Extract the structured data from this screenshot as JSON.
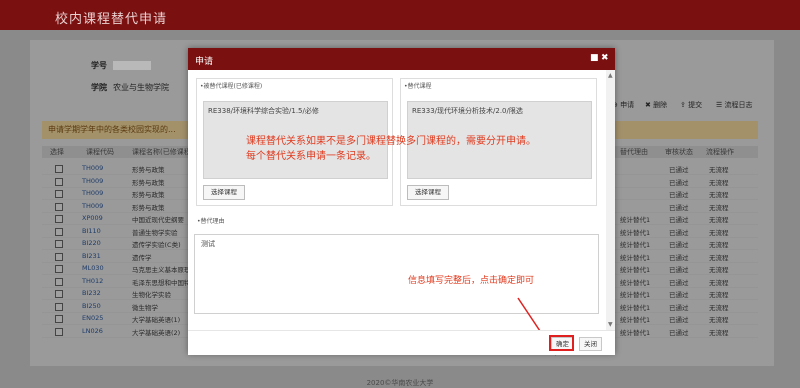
{
  "app": {
    "title": "校内课程替代申请"
  },
  "student": {
    "id_label": "学号",
    "college_label": "学院",
    "college_value": "农业与生物学院"
  },
  "toolbar": {
    "apply_label": "申请",
    "delete_label": "删除",
    "submit_label": "提交",
    "flow_label": "流程日志"
  },
  "notice": "申请学期学年中的各类校园实现的...",
  "table": {
    "headers": [
      "选择",
      "课程代码",
      "课程名称(已修课程)",
      "",
      "",
      "",
      "替代理由",
      "审核状态",
      "流程操作"
    ],
    "rows": [
      {
        "code": "TH009",
        "name": "形势与政策",
        "reason": "",
        "status": "已通过",
        "op": "无流程"
      },
      {
        "code": "TH009",
        "name": "形势与政策",
        "reason": "",
        "status": "已通过",
        "op": "无流程"
      },
      {
        "code": "TH009",
        "name": "形势与政策",
        "reason": "",
        "status": "已通过",
        "op": "无流程"
      },
      {
        "code": "TH009",
        "name": "形势与政策",
        "reason": "",
        "status": "已通过",
        "op": "无流程"
      },
      {
        "code": "XP009",
        "name": "中国近现代史纲要",
        "reason": "统计替代1",
        "status": "已通过",
        "op": "无流程"
      },
      {
        "code": "BI110",
        "name": "普通生物学实验",
        "reason": "统计替代1",
        "status": "已通过",
        "op": "无流程"
      },
      {
        "code": "BI220",
        "name": "遗传学实验(C类)",
        "reason": "统计替代1",
        "status": "已通过",
        "op": "无流程"
      },
      {
        "code": "BI231",
        "name": "遗传学",
        "reason": "统计替代1",
        "status": "已通过",
        "op": "无流程"
      },
      {
        "code": "ML030",
        "name": "马克思主义基本原理概论",
        "reason": "统计替代1",
        "status": "已通过",
        "op": "无流程"
      },
      {
        "code": "TH012",
        "name": "毛泽东思想和中国特色",
        "reason": "统计替代1",
        "status": "已通过",
        "op": "无流程"
      },
      {
        "code": "BI232",
        "name": "生物化学实验",
        "reason": "统计替代1",
        "status": "已通过",
        "op": "无流程"
      },
      {
        "code": "BI250",
        "name": "微生物学",
        "reason": "统计替代1",
        "status": "已通过",
        "op": "无流程"
      },
      {
        "code": "EN025",
        "name": "大学基础英语(1)",
        "reason": "统计替代1",
        "status": "已通过",
        "op": "无流程"
      },
      {
        "code": "LN026",
        "name": "大学基础英语(2)",
        "reason": "统计替代1",
        "status": "已通过",
        "op": "无流程"
      }
    ]
  },
  "footer": "2020©华南农业大学",
  "modal": {
    "title": "申请",
    "left_label": "被替代课程(已修课程)",
    "left_value": "RE338/环境科学综合实验/1.5/必修",
    "left_button": "选择课程",
    "right_label": "替代课程",
    "right_value": "RE333/现代环境分析技术/2.0/限选",
    "right_button": "选择课程",
    "reason_label": "替代理由",
    "reason_value": "测试",
    "annotation_1": "课程替代关系如果不是多门课程替换多门课程的，需要分开申请。",
    "annotation_2": "每个替代关系申请一条记录。",
    "annotation_3": "信息填写完整后，点击确定即可",
    "confirm_label": "确定",
    "close_label": "关闭"
  },
  "colors": {
    "brand": "#7a1010",
    "annotation": "#e03a1e"
  }
}
